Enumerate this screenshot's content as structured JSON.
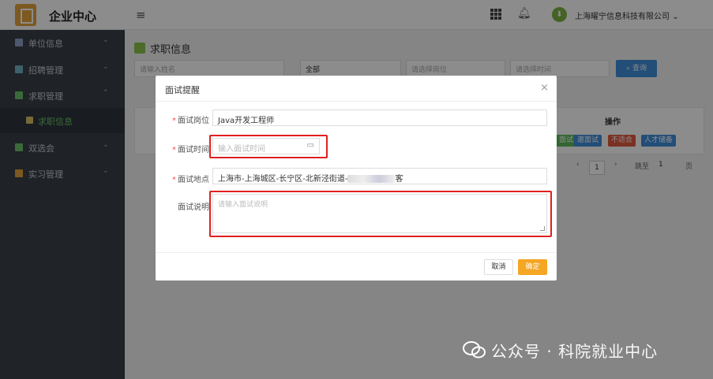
{
  "app": {
    "title": "企业中心",
    "company": "上海曜宁信息科技有限公司",
    "company_chevron": "⌄",
    "avatar": "⬇"
  },
  "sidebar": {
    "items": [
      {
        "label": "单位信息",
        "chevron": "⌄",
        "color": "#8ea1c7"
      },
      {
        "label": "招聘管理",
        "chevron": "⌄",
        "color": "#6fb3c0"
      },
      {
        "label": "求职管理",
        "chevron": "⌃",
        "color": "#6cc26a"
      },
      {
        "label": "双选会",
        "chevron": "⌄",
        "color": "#6cc26a"
      },
      {
        "label": "实习管理",
        "chevron": "⌄",
        "color": "#e2a33b"
      }
    ],
    "sub_item": {
      "label": "求职信息"
    }
  },
  "page": {
    "title": "求职信息",
    "filters": {
      "name_placeholder": "请输入姓名",
      "status": "全部",
      "position_placeholder": "请选择岗位",
      "time_placeholder": "请选择时间"
    },
    "search_label": "查询",
    "table": {
      "op_header": "操作",
      "op_buttons": [
        "面试",
        "邀面试",
        "不适合",
        "人才储备"
      ]
    },
    "pager": {
      "current": "1",
      "goto_label": "跳至",
      "goto_value": "1",
      "page_suffix": "页",
      "prev": "‹",
      "next": "›"
    }
  },
  "modal": {
    "title": "面试提醒",
    "close": "×",
    "fields": {
      "position": {
        "label": "面试岗位",
        "value": "Java开发工程师",
        "required": "*"
      },
      "time": {
        "label": "面试时间",
        "placeholder": "输入面试时间",
        "required": "*"
      },
      "location": {
        "label": "面试地点",
        "value_prefix": "上海市-上海城区-长宁区-北新泾街道-",
        "value_suffix": "客",
        "required": "*"
      },
      "description": {
        "label": "面试说明",
        "placeholder": "请输入面试说明"
      }
    },
    "cancel_label": "取消",
    "ok_label": "确定"
  },
  "watermark": {
    "text": "公众号 · 科院就业中心"
  },
  "colors": {
    "accent": "#f5a623",
    "highlight": "#e02020",
    "search": "#3f8edb"
  }
}
